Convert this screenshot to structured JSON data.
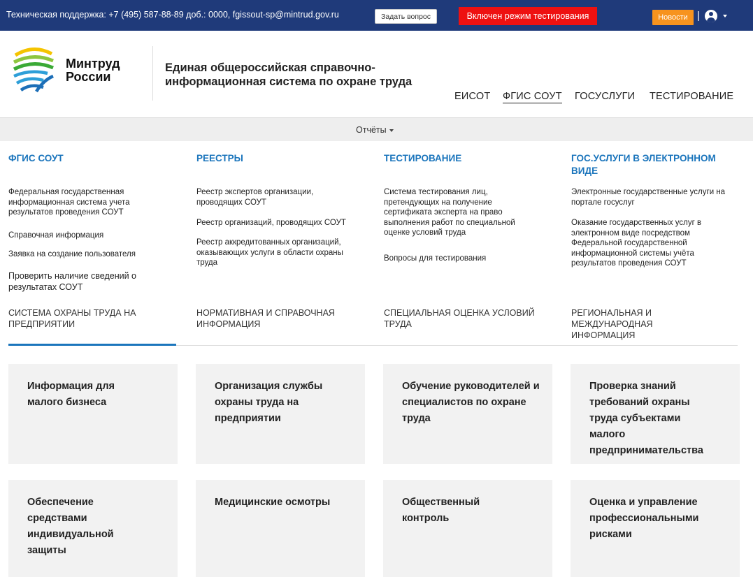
{
  "topbar": {
    "support_text": "Техническая поддержка: +7 (495) 587-88-89 доб.: 0000, fgissout-sp@mintrud.gov.ru",
    "ask_button": "Задать вопрос",
    "test_mode": "Включен режим тестирования",
    "news_button": "Новости",
    "separator": "|",
    "colors": {
      "bar": "#1f3a7a",
      "test_mode": "#ee1111",
      "news": "#f7931e"
    }
  },
  "header": {
    "logo_line1": "Минтруд",
    "logo_line2": "России",
    "site_title_line1": "Единая общероссийская справочно-",
    "site_title_line2": "информационная система по охране труда",
    "nav": [
      {
        "label": "ЕИСОТ"
      },
      {
        "label": "ФГИС СОУТ",
        "active": true
      },
      {
        "label": "ГОСУСЛУГИ"
      },
      {
        "label": "ТЕСТИРОВАНИЕ"
      }
    ]
  },
  "reports": {
    "label": "Отчёты"
  },
  "menu": {
    "fgis": {
      "title": "ФГИС СОУТ",
      "links": [
        "Федеральная государственная информационная система учета результатов проведения СОУТ",
        "Справочная информация",
        "Заявка на создание пользователя",
        "Проверить наличие сведений о результатах СОУТ"
      ]
    },
    "registries": {
      "title": "РЕЕСТРЫ",
      "links": [
        "Реестр экспертов организации, проводящих СОУТ",
        "Реестр организаций, проводящих СОУТ",
        "Реестр аккредитованных организаций, оказывающих услуги в области охраны труда"
      ]
    },
    "testing": {
      "title": "ТЕСТИРОВАНИЕ",
      "links": [
        "Система тестирования лиц, претендующих на получение сертификата эксперта на право выполнения работ по специальной оценке условий труда",
        "Вопросы для тестирования"
      ]
    },
    "gosuslugi": {
      "title": "ГОС.УСЛУГИ В ЭЛЕКТРОННОМ ВИДЕ",
      "links": [
        "Электронные государственные услуги на портале госуслуг",
        "Оказание государственных услуг в электронном виде посредством Федеральной государственной информационной системы учёта результатов проведения СОУТ"
      ]
    },
    "accent_color": "#1b75bc"
  },
  "tabs": [
    {
      "label": "СИСТЕМА ОХРАНЫ ТРУДА НА ПРЕДПРИЯТИИ",
      "active": true
    },
    {
      "label": "НОРМАТИВНАЯ И СПРАВОЧНАЯ ИНФОРМАЦИЯ"
    },
    {
      "label": "СПЕЦИАЛЬНАЯ ОЦЕНКА УСЛОВИЙ ТРУДА"
    },
    {
      "label": "РЕГИОНАЛЬНАЯ И МЕЖДУНАРОДНАЯ ИНФОРМАЦИЯ"
    }
  ],
  "cards": [
    "Информация для малого бизнеса",
    "Организация службы охраны труда на предприятии",
    "Обучение руководителей и специалистов по охране труда",
    "Проверка знаний требований охраны труда субъектами малого предпринимательства",
    "Обеспечение средствами индивидуальной защиты",
    "Медицинские осмотры",
    "Общественный контроль",
    "Оценка и управление профессиональными рисками"
  ]
}
